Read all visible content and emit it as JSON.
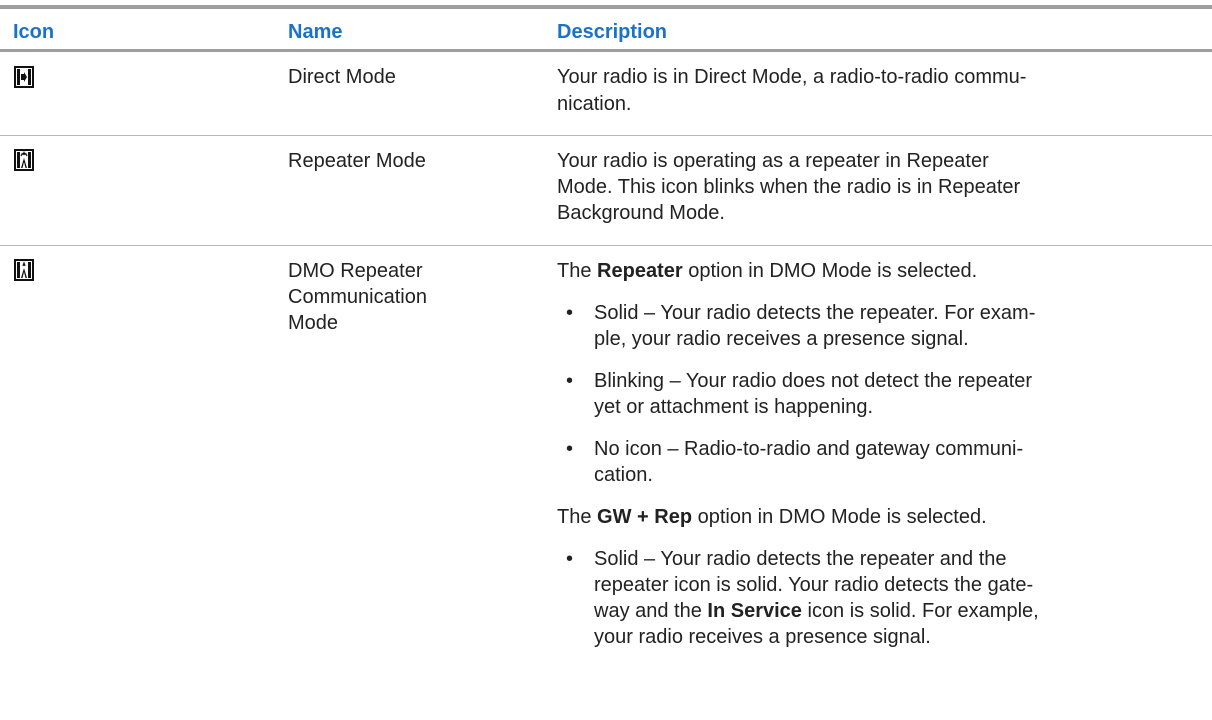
{
  "table": {
    "headers": {
      "icon": "Icon",
      "name": "Name",
      "description": "Description"
    },
    "rows": [
      {
        "icon": "direct-mode-icon",
        "name": "Direct Mode",
        "description_line1": "Your radio is in Direct Mode, a radio-to-radio commu-",
        "description_line2": "nication."
      },
      {
        "icon": "repeater-mode-icon",
        "name": "Repeater Mode",
        "description_line1": "Your radio is operating as a repeater in Repeater",
        "description_line2": "Mode. This icon blinks when the radio is in Repeater",
        "description_line3": "Background Mode."
      },
      {
        "icon": "dmo-repeater-communication-mode-icon",
        "name_line1": "DMO Repeater",
        "name_line2": "Communication",
        "name_line3": "Mode",
        "intro1_pre": "The ",
        "intro1_bold": "Repeater",
        "intro1_post": " option in DMO Mode is selected.",
        "bullets1": [
          {
            "line1": "Solid – Your radio detects the repeater. For exam-",
            "line2": "ple, your radio receives a presence signal."
          },
          {
            "line1": "Blinking – Your radio does not detect the repeater",
            "line2": "yet or attachment is happening."
          },
          {
            "line1": "No icon – Radio-to-radio and gateway communi-",
            "line2": "cation."
          }
        ],
        "intro2_pre": "The ",
        "intro2_bold": "GW + Rep",
        "intro2_post": " option in DMO Mode is selected.",
        "bullet2": {
          "line1": "Solid – Your radio detects the repeater and the",
          "line2": "repeater icon is solid. Your radio detects the gate-",
          "line3_pre": "way and the ",
          "line3_bold": "In Service",
          "line3_post": " icon is solid. For example,",
          "line4": "your radio receives a presence signal."
        },
        "bullet_char": "•"
      }
    ]
  }
}
